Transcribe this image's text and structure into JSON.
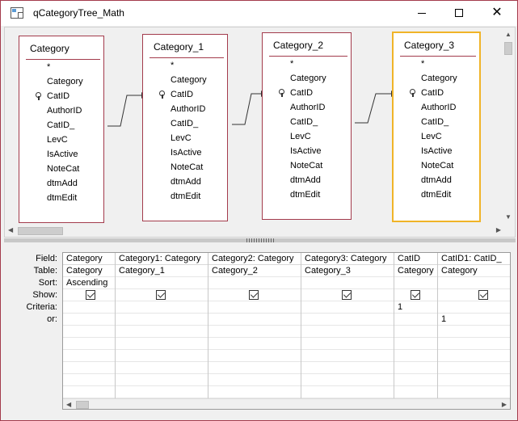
{
  "window": {
    "title": "qCategoryTree_Math",
    "close_glyph": "✕"
  },
  "tables": [
    {
      "title": "Category",
      "fields": [
        "*",
        "Category",
        "CatID",
        "AuthorID",
        "CatID_",
        "LevC",
        "IsActive",
        "NoteCat",
        "dtmAdd",
        "dtmEdit"
      ],
      "key_field": "CatID"
    },
    {
      "title": "Category_1",
      "fields": [
        "*",
        "Category",
        "CatID",
        "AuthorID",
        "CatID_",
        "LevC",
        "IsActive",
        "NoteCat",
        "dtmAdd",
        "dtmEdit"
      ],
      "key_field": "CatID"
    },
    {
      "title": "Category_2",
      "fields": [
        "*",
        "Category",
        "CatID",
        "AuthorID",
        "CatID_",
        "LevC",
        "IsActive",
        "NoteCat",
        "dtmAdd",
        "dtmEdit"
      ],
      "key_field": "CatID"
    },
    {
      "title": "Category_3",
      "fields": [
        "*",
        "Category",
        "CatID",
        "AuthorID",
        "CatID_",
        "LevC",
        "IsActive",
        "NoteCat",
        "dtmAdd",
        "dtmEdit"
      ],
      "key_field": "CatID",
      "selected": true
    }
  ],
  "grid": {
    "row_labels": [
      "Field:",
      "Table:",
      "Sort:",
      "Show:",
      "Criteria:",
      "or:"
    ],
    "columns": [
      {
        "field": "Category",
        "table": "Category",
        "sort": "Ascending",
        "show": true,
        "criteria": "",
        "or": ""
      },
      {
        "field": "Category1: Category",
        "table": "Category_1",
        "sort": "",
        "show": true,
        "criteria": "",
        "or": ""
      },
      {
        "field": "Category2: Category",
        "table": "Category_2",
        "sort": "",
        "show": true,
        "criteria": "",
        "or": ""
      },
      {
        "field": "Category3: Category",
        "table": "Category_3",
        "sort": "",
        "show": true,
        "criteria": "",
        "or": ""
      },
      {
        "field": "CatID",
        "table": "Category",
        "sort": "",
        "show": true,
        "criteria": "1",
        "or": ""
      },
      {
        "field": "CatID1: CatID_",
        "table": "Category",
        "sort": "",
        "show": true,
        "criteria": "",
        "or": "1"
      }
    ]
  },
  "icons": {
    "app": "query-design-icon",
    "key": "primary-key-icon"
  },
  "colors": {
    "accent": "#a33b4c",
    "selected_border": "#f0b428"
  }
}
